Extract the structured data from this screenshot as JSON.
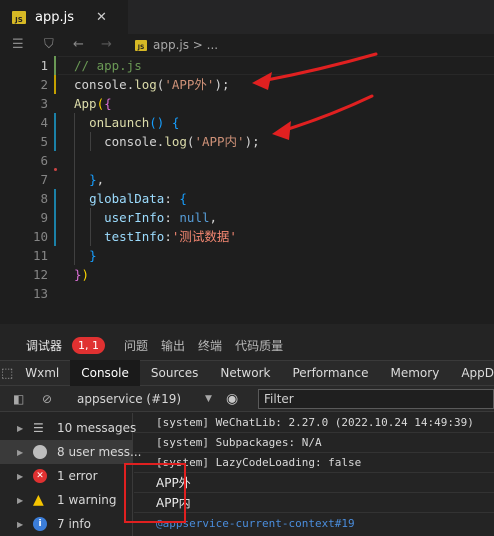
{
  "tab": {
    "file_badge": "JS",
    "name": "app.js",
    "close": "✕"
  },
  "breadcrumb": {
    "path": "app.js > ..."
  },
  "editor": {
    "lines": [
      {
        "n": "1"
      },
      {
        "n": "2"
      },
      {
        "n": "3"
      },
      {
        "n": "4"
      },
      {
        "n": "5"
      },
      {
        "n": "6"
      },
      {
        "n": "7"
      },
      {
        "n": "8"
      },
      {
        "n": "9"
      },
      {
        "n": "10"
      },
      {
        "n": "11"
      },
      {
        "n": "12"
      },
      {
        "n": "13"
      }
    ],
    "code": {
      "l1": "// app.js",
      "l2_obj": "console",
      "l2_dot": ".",
      "l2_fn": "log",
      "l2_open": "(",
      "l2_str": "'APP外'",
      "l2_close": ");",
      "l3_fn": "App",
      "l3_paren": "(",
      "l3_brace": "{",
      "l4_fn": "onLaunch",
      "l4_rest": "() ",
      "l4_brace": "{",
      "l5_obj": "console",
      "l5_dot": ".",
      "l5_fn": "log",
      "l5_open": "(",
      "l5_str": "'APP内'",
      "l5_close": ");",
      "l7_brace": "}",
      "l7_comma": ",",
      "l8_key": "globalData",
      "l8_colon": ": ",
      "l8_brace": "{",
      "l9_key": "userInfo",
      "l9_colon": ": ",
      "l9_val": "null",
      "l9_comma": ",",
      "l10_key": "testInfo",
      "l10_colon": ":",
      "l10_str": "'测试数据'",
      "l11_brace": "}",
      "l12_brace": "}",
      "l12_paren": ")"
    }
  },
  "devtools": {
    "tabs": [
      "调试器",
      "问题",
      "输出",
      "终端",
      "代码质量"
    ],
    "error_badge": "1, 1",
    "sub_tabs": [
      "Wxml",
      "Console",
      "Sources",
      "Network",
      "Performance",
      "Memory",
      "AppD"
    ],
    "selected_sub_tab": "Console",
    "context": "appservice (#19)",
    "filter_placeholder": "Filter",
    "sidebar": [
      {
        "label": "10 messages",
        "icon": "list-icon"
      },
      {
        "label": "8 user mess...",
        "icon": "user-icon"
      },
      {
        "label": "1 error",
        "icon": "error-icon"
      },
      {
        "label": "1 warning",
        "icon": "warning-icon"
      },
      {
        "label": "7 info",
        "icon": "info-icon"
      }
    ],
    "console_lines": [
      "[system] WeChatLib: 2.27.0 (2022.10.24 14:49:39)",
      "[system] Subpackages: N/A",
      "[system] LazyCodeLoading: false",
      "APP外",
      "APP内",
      "@appservice-current-context#19"
    ]
  },
  "colors": {
    "accent_red": "#e02020",
    "error_badge": "#e03131"
  }
}
